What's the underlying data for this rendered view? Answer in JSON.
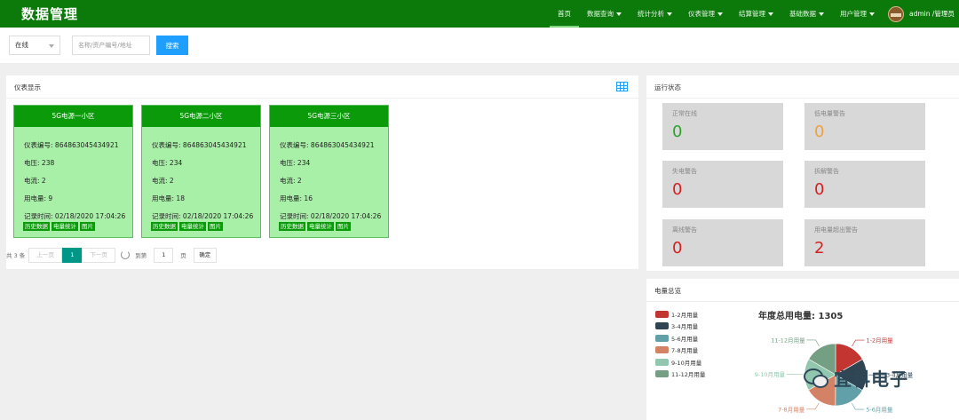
{
  "header": {
    "brand": "数据管理",
    "nav": [
      {
        "label": "首页",
        "active": true,
        "dropdown": false
      },
      {
        "label": "数据查询",
        "dropdown": true
      },
      {
        "label": "统计分析",
        "dropdown": true
      },
      {
        "label": "仪表管理",
        "dropdown": true
      },
      {
        "label": "结算管理",
        "dropdown": true
      },
      {
        "label": "基础数据",
        "dropdown": true
      },
      {
        "label": "用户管理",
        "dropdown": true
      }
    ],
    "user": "admin /管理员"
  },
  "search": {
    "status_selected": "在线",
    "placeholder": "名称/资产编号/地址",
    "button": "搜索"
  },
  "meter_panel": {
    "title": "仪表显示",
    "cards": [
      {
        "name": "5G电源一小区",
        "id_label": "仪表编号:",
        "id": "864863045434921",
        "voltage_label": "电压:",
        "voltage": "238",
        "current_label": "电流:",
        "current": "2",
        "usage_label": "用电量:",
        "usage": "9",
        "time_label": "记录时间:",
        "time": "02/18/2020 17:04:26"
      },
      {
        "name": "5G电源二小区",
        "id_label": "仪表编号:",
        "id": "864863045434921",
        "voltage_label": "电压:",
        "voltage": "234",
        "current_label": "电流:",
        "current": "2",
        "usage_label": "用电量:",
        "usage": "18",
        "time_label": "记录时间:",
        "time": "02/18/2020 17:04:26"
      },
      {
        "name": "5G电源三小区",
        "id_label": "仪表编号:",
        "id": "864863045434921",
        "voltage_label": "电压:",
        "voltage": "234",
        "current_label": "电流:",
        "current": "2",
        "usage_label": "用电量:",
        "usage": "16",
        "time_label": "记录时间:",
        "time": "02/18/2020 17:04:26"
      }
    ],
    "card_buttons": [
      "历史数据",
      "电量统计",
      "图片"
    ],
    "pager": {
      "total": "共 3 条",
      "prev": "上一页",
      "current": "1",
      "next": "下一页",
      "goto_label": "到第",
      "goto_value": "1",
      "page_label": "页",
      "confirm": "确定"
    }
  },
  "status_panel": {
    "title": "运行状态",
    "items": [
      {
        "label": "正常在线",
        "value": "0",
        "color": "#2aa52a"
      },
      {
        "label": "低电量警告",
        "value": "0",
        "color": "#f0a040"
      },
      {
        "label": "失电警告",
        "value": "0",
        "color": "#d62020"
      },
      {
        "label": "拆解警告",
        "value": "0",
        "color": "#d62020"
      },
      {
        "label": "离线警告",
        "value": "0",
        "color": "#d62020"
      },
      {
        "label": "用电量超出警告",
        "value": "2",
        "color": "#d62020"
      }
    ]
  },
  "electricity_panel": {
    "title": "电量总览",
    "annual_label": "年度总用电量: 1305"
  },
  "chart_data": {
    "type": "pie",
    "title": "年度总用电量: 1305",
    "series": [
      {
        "name": "1-2月用量",
        "color": "#c23531"
      },
      {
        "name": "3-4月用量",
        "color": "#2f4554"
      },
      {
        "name": "5-6月用量",
        "color": "#61a0a8"
      },
      {
        "name": "7-8月用量",
        "color": "#d48265"
      },
      {
        "name": "9-10月用量",
        "color": "#91c7ae"
      },
      {
        "name": "11-12月用量",
        "color": "#749f83"
      }
    ],
    "values": [
      16.7,
      16.7,
      16.7,
      16.7,
      16.6,
      16.6
    ],
    "legend": "left"
  },
  "watermark": "宜科电子"
}
